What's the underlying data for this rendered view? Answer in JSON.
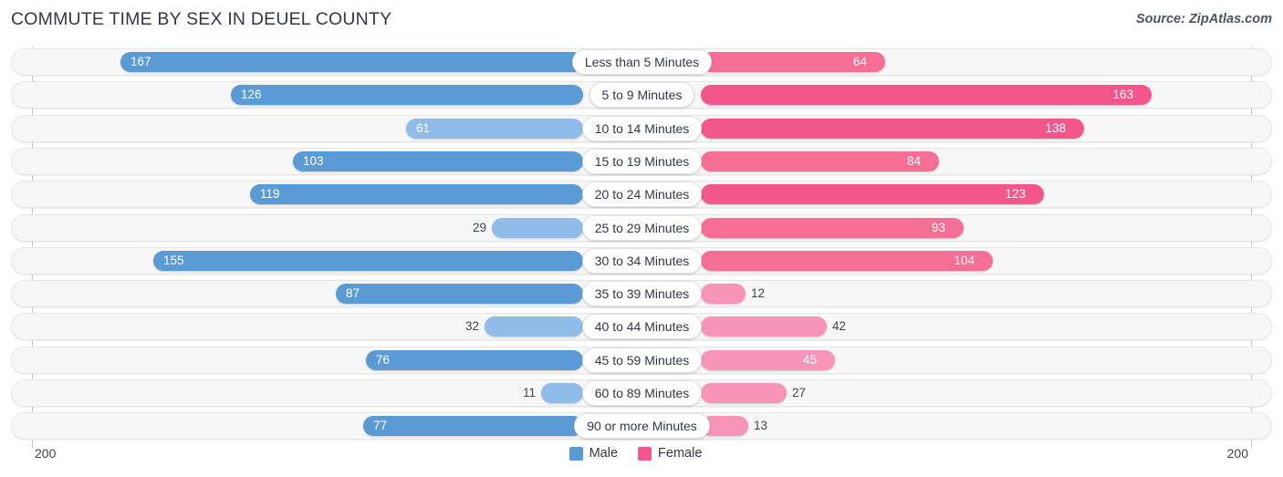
{
  "header": {
    "title": "COMMUTE TIME BY SEX IN DEUEL COUNTY",
    "source": "Source: ZipAtlas.com"
  },
  "axis": {
    "left_tick": "200",
    "right_tick": "200"
  },
  "legend": {
    "items": [
      {
        "label": "Male",
        "color": "#5b9bd5"
      },
      {
        "label": "Female",
        "color": "#f2568a"
      }
    ]
  },
  "colors": {
    "male_strong": "#5b9bd5",
    "male_light": "#8fbce8",
    "female_strong": "#f2568a",
    "female_mid": "#f46e95",
    "female_light": "#f794b7",
    "track": "#f7f7f7",
    "axis": "#c9c9c9"
  },
  "chart_data": {
    "type": "bar",
    "subtype": "diverging-bidirectional",
    "title": "COMMUTE TIME BY SEX IN DEUEL COUNTY",
    "xlabel": "",
    "ylabel": "",
    "xlim": [
      200,
      200
    ],
    "axis_max": 200,
    "grid": false,
    "legend_position": "bottom-center",
    "categories": [
      "Less than 5 Minutes",
      "5 to 9 Minutes",
      "10 to 14 Minutes",
      "15 to 19 Minutes",
      "20 to 24 Minutes",
      "25 to 29 Minutes",
      "30 to 34 Minutes",
      "35 to 39 Minutes",
      "40 to 44 Minutes",
      "45 to 59 Minutes",
      "60 to 89 Minutes",
      "90 or more Minutes"
    ],
    "series": [
      {
        "name": "Male",
        "direction": "left",
        "color": "#5b9bd5",
        "values": [
          167,
          126,
          61,
          103,
          119,
          29,
          155,
          87,
          32,
          76,
          11,
          77
        ]
      },
      {
        "name": "Female",
        "direction": "right",
        "color": "#f2568a",
        "values": [
          64,
          163,
          138,
          84,
          123,
          93,
          104,
          12,
          42,
          45,
          27,
          13
        ]
      }
    ]
  }
}
